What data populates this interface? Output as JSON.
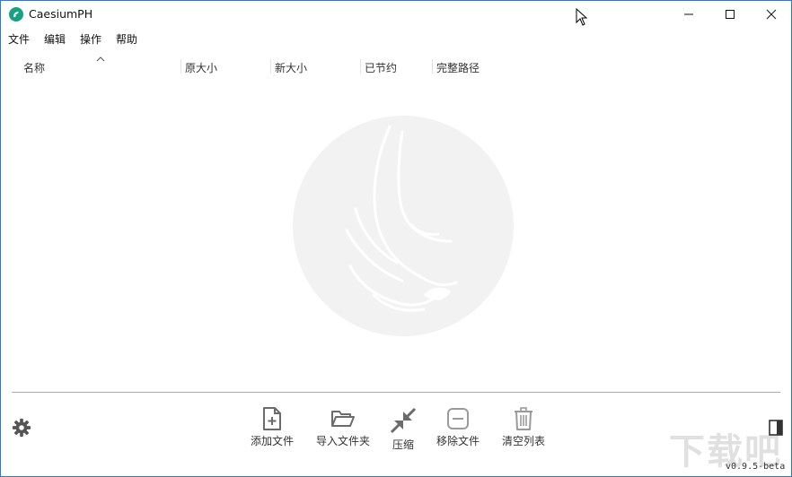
{
  "window": {
    "title": "CaesiumPH"
  },
  "menu": [
    "文件",
    "编辑",
    "操作",
    "帮助"
  ],
  "columns": [
    "名称",
    "原大小",
    "新大小",
    "已节约",
    "完整路径"
  ],
  "toolbar": {
    "add_file": "添加文件",
    "import_folder": "导入文件夹",
    "compress": "压缩",
    "remove_file": "移除文件",
    "clear_list": "清空列表"
  },
  "version": "v0.9.5-beta",
  "corner_watermark": "下载吧",
  "colors": {
    "accent": "#16a184",
    "window_border": "#2b79d8",
    "icon_gray": "#6b6b6b"
  }
}
